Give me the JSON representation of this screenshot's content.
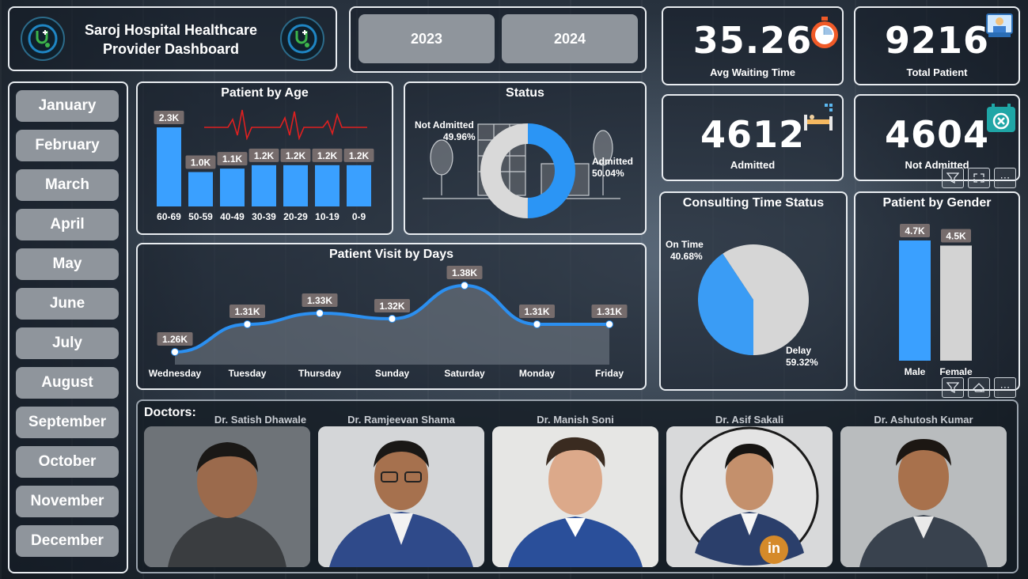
{
  "header": {
    "title_line1": "Saroj Hospital Healthcare",
    "title_line2": "Provider Dashboard"
  },
  "years": [
    "2023",
    "2024"
  ],
  "months": [
    "January",
    "February",
    "March",
    "April",
    "May",
    "June",
    "July",
    "August",
    "September",
    "October",
    "November",
    "December"
  ],
  "kpis": {
    "avg_waiting": {
      "value": "35.26",
      "label": "Avg Waiting Time",
      "icon": "stopwatch-icon"
    },
    "total_patient": {
      "value": "9216",
      "label": "Total Patient",
      "icon": "patient-bed-icon"
    },
    "admitted": {
      "value": "4612",
      "label": "Admitted",
      "icon": "hospital-bed-icon"
    },
    "not_admitted": {
      "value": "4604",
      "label": "Not Admitted",
      "icon": "calendar-cancel-icon"
    }
  },
  "patient_by_age": {
    "title": "Patient by Age",
    "chart_data": {
      "type": "bar",
      "categories": [
        "60-69",
        "50-59",
        "40-49",
        "30-39",
        "20-29",
        "10-19",
        "0-9"
      ],
      "values": [
        2300,
        1000,
        1100,
        1200,
        1200,
        1200,
        1200
      ],
      "labels": [
        "2.3K",
        "1.0K",
        "1.1K",
        "1.2K",
        "1.2K",
        "1.2K",
        "1.2K"
      ],
      "color": "#3aa0ff"
    }
  },
  "status": {
    "title": "Status",
    "chart_data": {
      "type": "pie",
      "slices": [
        {
          "name": "Admitted",
          "value": 50.04,
          "label": "50.04%",
          "color": "#2b95f5"
        },
        {
          "name": "Not Admitted",
          "value": 49.96,
          "label": "49.96%",
          "color": "#d9d9d9"
        }
      ]
    }
  },
  "visits_by_day": {
    "title": "Patient Visit by Days",
    "chart_data": {
      "type": "area",
      "categories": [
        "Wednesday",
        "Tuesday",
        "Thursday",
        "Sunday",
        "Saturday",
        "Monday",
        "Friday"
      ],
      "values": [
        1260,
        1310,
        1330,
        1320,
        1380,
        1310,
        1310
      ],
      "labels": [
        "1.26K",
        "1.31K",
        "1.33K",
        "1.32K",
        "1.38K",
        "1.31K",
        "1.31K"
      ],
      "color": "#2b8ff0"
    }
  },
  "consulting": {
    "title": "Consulting Time Status",
    "chart_data": {
      "type": "pie",
      "slices": [
        {
          "name": "On Time",
          "value": 40.68,
          "label": "40.68%",
          "color": "#3a9cf5"
        },
        {
          "name": "Delay",
          "value": 59.32,
          "label": "59.32%",
          "color": "#d6d6d6"
        }
      ]
    }
  },
  "gender": {
    "title": "Patient by Gender",
    "chart_data": {
      "type": "bar",
      "categories": [
        "Male",
        "Female"
      ],
      "values": [
        4700,
        4500
      ],
      "labels": [
        "4.7K",
        "4.5K"
      ],
      "colors": [
        "#3aa0ff",
        "#d3d3d3"
      ]
    }
  },
  "doctors": {
    "label": "Doctors:",
    "names": [
      "Dr. Satish Dhawale",
      "Dr. Ramjeevan Shama",
      "Dr. Manish Soni",
      "Dr. Asif Sakali",
      "Dr. Ashutosh Kumar"
    ],
    "linkedin_badge": "in"
  }
}
